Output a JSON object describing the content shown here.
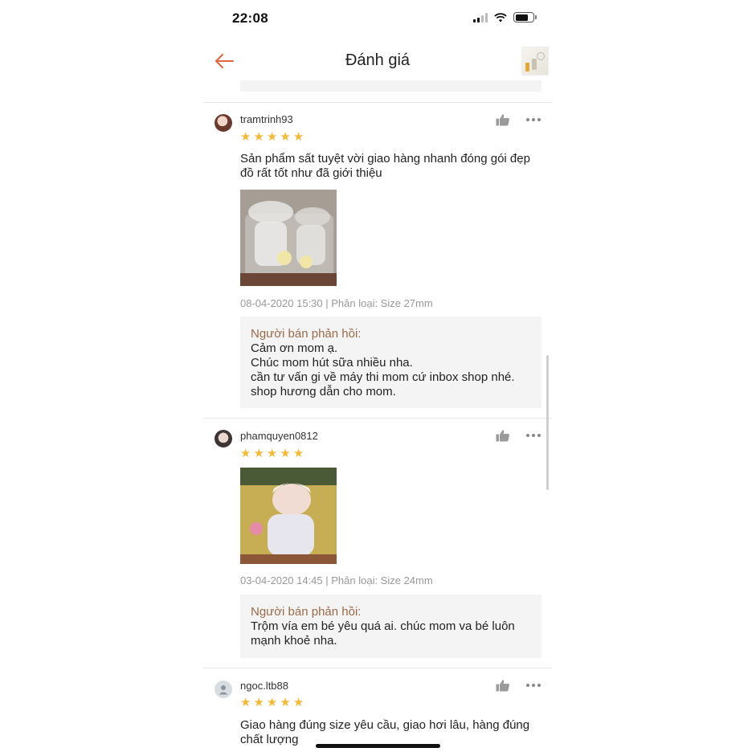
{
  "status": {
    "time": "22:08"
  },
  "header": {
    "title": "Đánh giá"
  },
  "reviews": [
    {
      "username": "tramtrinh93",
      "rating": 5,
      "comment": "Sản phẩm sất tuyệt vời giao hàng nhanh đóng gói đẹp đồ rất tốt như đã giới thiệu",
      "meta": "08-04-2020 15:30 | Phân loại: Size 27mm",
      "reply_label": "Người bán phản hồi:",
      "reply_text": "Cảm ơn mom ạ.\nChúc mom hút sữa nhiều nha.\ncần tư vấn gi về máy thi mom cứ inbox shop nhé.\nshop hương dẫn cho mom."
    },
    {
      "username": "phamquyen0812",
      "rating": 5,
      "meta": "03-04-2020 14:45 | Phân loại: Size 24mm",
      "reply_label": "Người bán phản hồi:",
      "reply_text": "Trộm vía em bé yêu quá ai. chúc mom va bé luôn mạnh khoẻ nha."
    },
    {
      "username": "ngoc.ltb88",
      "rating": 5,
      "comment": "Giao hàng đúng size yêu cầu, giao hơi lâu, hàng đúng chất lượng"
    }
  ],
  "colors": {
    "accent": "#e2643c",
    "star": "#f5b93a",
    "reply_label": "#9b6a4a"
  },
  "icons": {
    "back": "arrow-left-icon",
    "like": "thumbs-up-icon",
    "more": "more-horizontal-icon"
  }
}
